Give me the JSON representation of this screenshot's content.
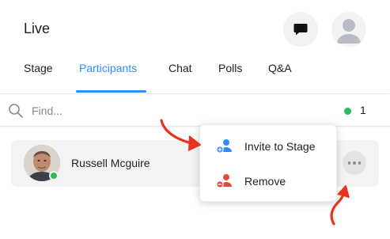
{
  "header": {
    "title": "Live"
  },
  "tabs": [
    {
      "label": "Stage"
    },
    {
      "label": "Participants",
      "active": true
    },
    {
      "label": "Chat"
    },
    {
      "label": "Polls"
    },
    {
      "label": "Q&A"
    }
  ],
  "search": {
    "placeholder": "Find...",
    "value": ""
  },
  "participant_count": "1",
  "participants": [
    {
      "name": "Russell Mcguire",
      "status": "online"
    }
  ],
  "menu": {
    "items": [
      {
        "label": "Invite to Stage",
        "icon": "invite-user-icon"
      },
      {
        "label": "Remove",
        "icon": "remove-user-icon"
      }
    ]
  },
  "colors": {
    "accent": "#2d8cff",
    "online": "#2eb85c",
    "danger": "#e5483d",
    "annotation": "#e8341c"
  }
}
